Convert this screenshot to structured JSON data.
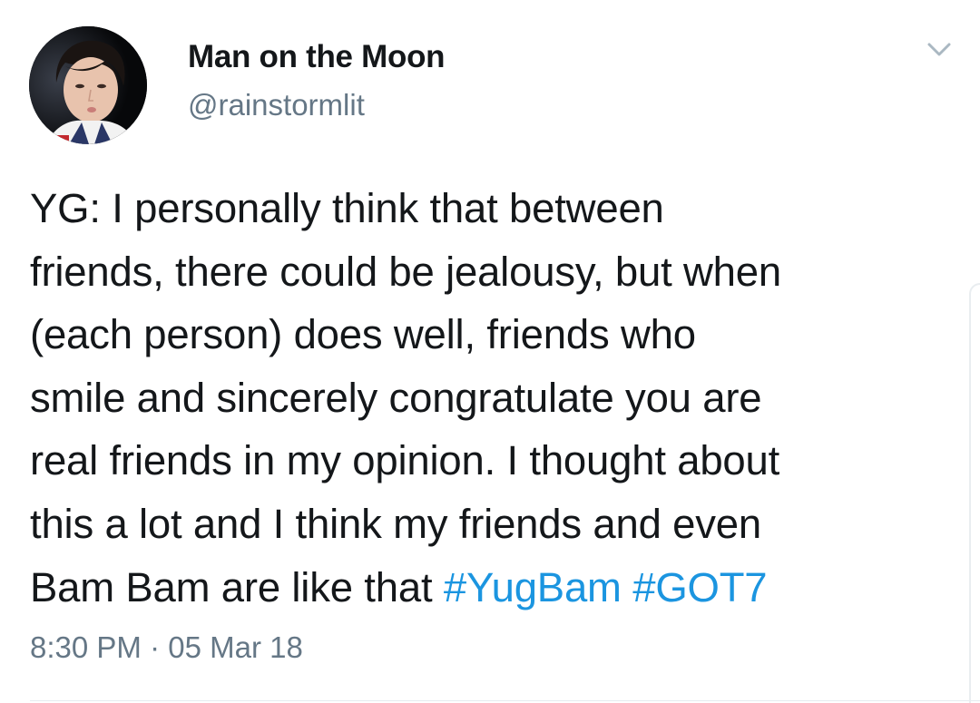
{
  "tweet": {
    "author": {
      "display_name": "Man on the Moon",
      "handle": "@rainstormlit",
      "avatar": "profile-photo"
    },
    "menu_icon": "chevron-down-icon",
    "text_lines": [
      "YG: I personally think that between",
      "friends, there could be jealousy, but when",
      "(each person) does well, friends who",
      "smile and sincerely congratulate you are",
      "real friends in my opinion. I thought about",
      "this a lot and I think my friends and even",
      "Bam Bam are like that "
    ],
    "hashtags": [
      "#YugBam",
      "#GOT7"
    ],
    "time": "8:30 PM",
    "separator": " · ",
    "date": "05 Mar 18",
    "colors": {
      "text": "#14171a",
      "secondary": "#657786",
      "hashtag": "#1b95e0"
    }
  }
}
